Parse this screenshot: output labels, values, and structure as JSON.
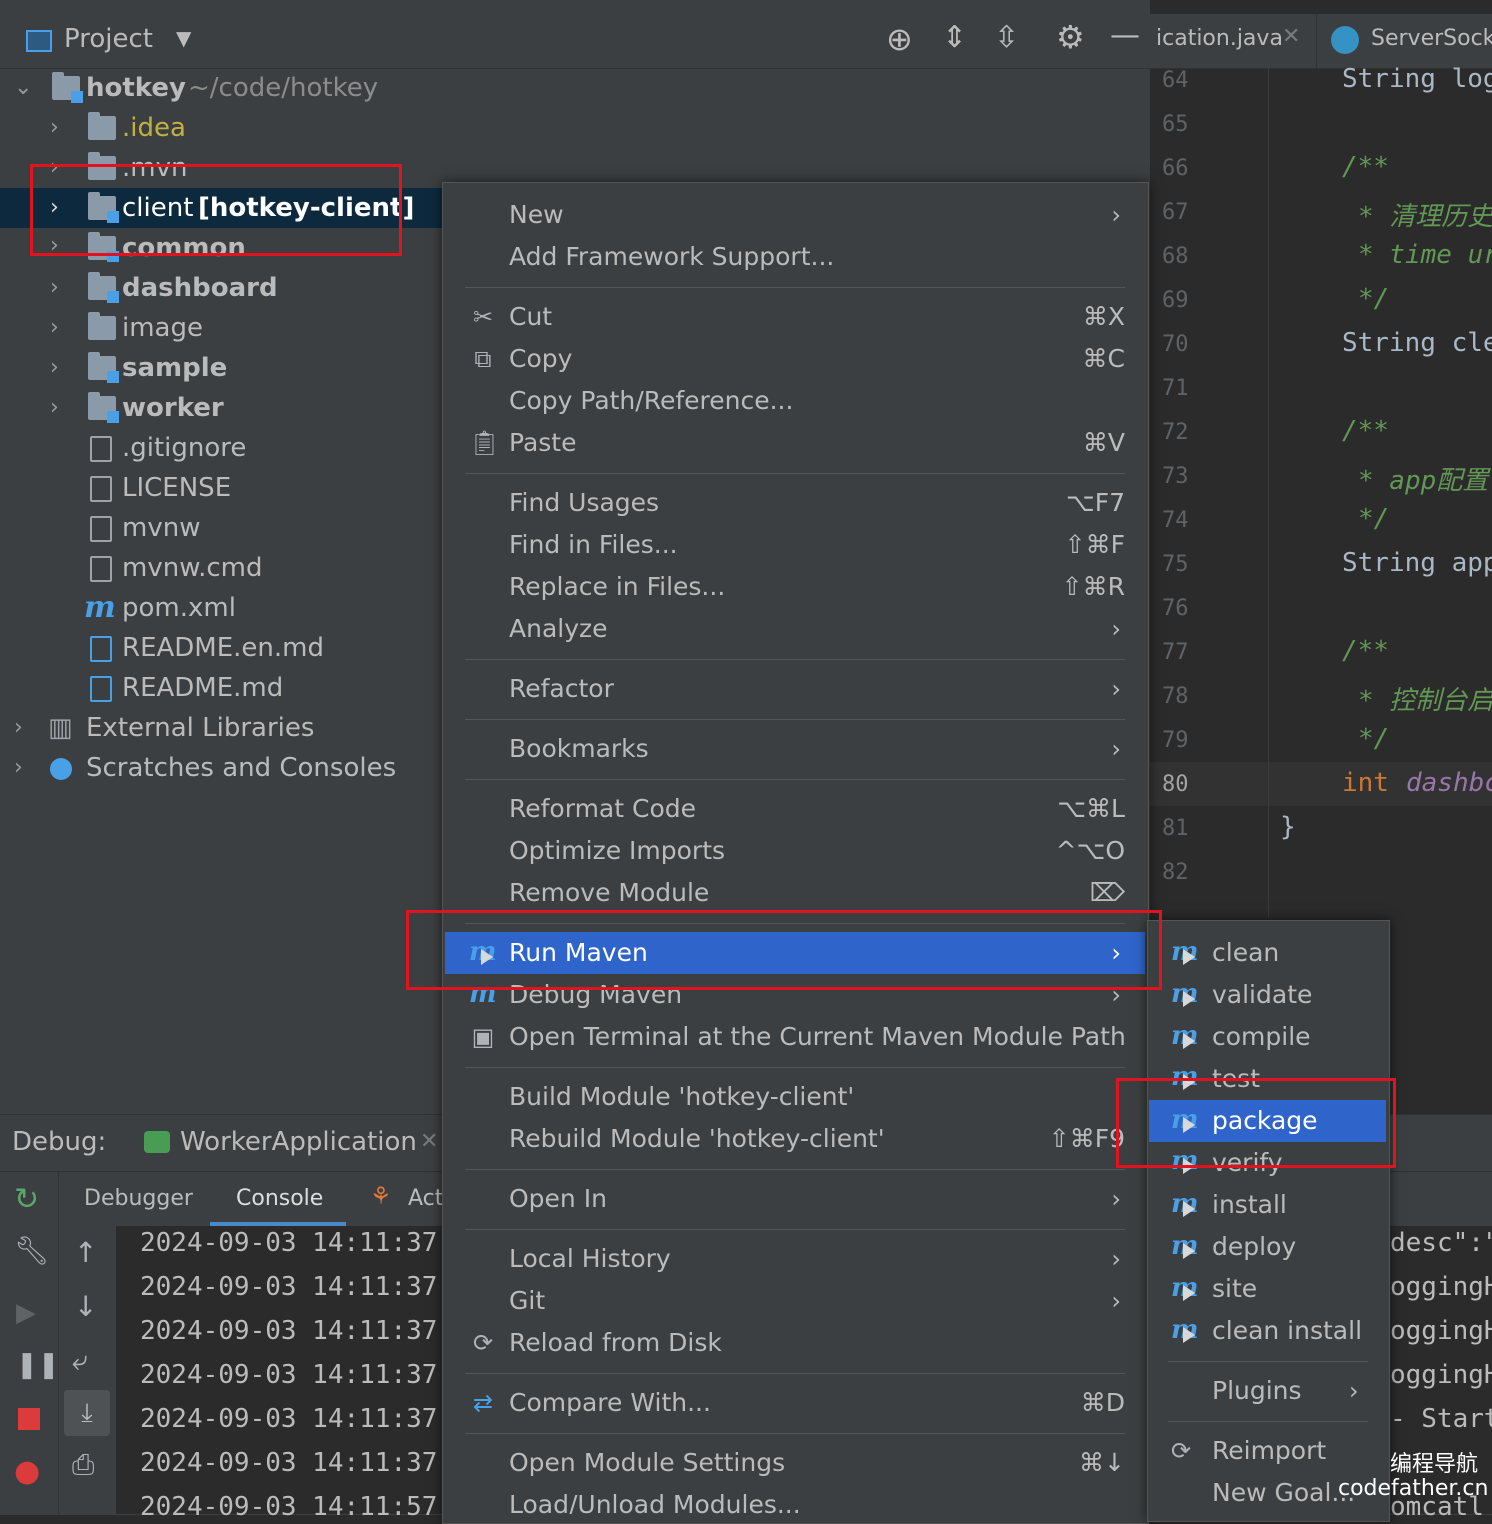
{
  "project_panel": {
    "title": "Project",
    "tree": [
      {
        "label": "hotkey",
        "path": "~/code/hotkey"
      },
      {
        "label": ".idea"
      },
      {
        "label": ".mvn"
      },
      {
        "label": "client",
        "module": "[hotkey-client]"
      },
      {
        "label": "common"
      },
      {
        "label": "dashboard"
      },
      {
        "label": "image"
      },
      {
        "label": "sample"
      },
      {
        "label": "worker"
      },
      {
        "label": ".gitignore"
      },
      {
        "label": "LICENSE"
      },
      {
        "label": "mvnw"
      },
      {
        "label": "mvnw.cmd"
      },
      {
        "label": "pom.xml"
      },
      {
        "label": "README.en.md"
      },
      {
        "label": "README.md"
      },
      {
        "label": "External Libraries"
      },
      {
        "label": "Scratches and Consoles"
      }
    ]
  },
  "editor": {
    "tabs": [
      {
        "label": "ication.java"
      },
      {
        "label": "ServerSocke"
      }
    ],
    "line_numbers": [
      "64",
      "65",
      "66",
      "67",
      "68",
      "69",
      "70",
      "71",
      "72",
      "73",
      "74",
      "75",
      "76",
      "77",
      "78",
      "79",
      "80",
      "81",
      "82"
    ],
    "code_lines": [
      "String log",
      "/**",
      "* 清理历史",
      "* time ur",
      "*/",
      "String cle",
      "/**",
      "* app配置",
      "*/",
      "String app",
      "/**",
      "* 控制台启",
      "*/",
      "int",
      "dashbc",
      "}"
    ]
  },
  "context_menu": {
    "items": [
      {
        "label": "New"
      },
      {
        "label": "Add Framework Support..."
      },
      {
        "label": "Cut",
        "shortcut": "⌘X"
      },
      {
        "label": "Copy",
        "shortcut": "⌘C"
      },
      {
        "label": "Copy Path/Reference..."
      },
      {
        "label": "Paste",
        "shortcut": "⌘V"
      },
      {
        "label": "Find Usages",
        "shortcut": "⌥F7"
      },
      {
        "label": "Find in Files...",
        "shortcut": "⇧⌘F"
      },
      {
        "label": "Replace in Files...",
        "shortcut": "⇧⌘R"
      },
      {
        "label": "Analyze"
      },
      {
        "label": "Refactor"
      },
      {
        "label": "Bookmarks"
      },
      {
        "label": "Reformat Code",
        "shortcut": "⌥⌘L"
      },
      {
        "label": "Optimize Imports",
        "shortcut": "^⌥O"
      },
      {
        "label": "Remove Module",
        "shortcut": "⌦"
      },
      {
        "label": "Run Maven"
      },
      {
        "label": "Debug Maven"
      },
      {
        "label": "Open Terminal at the Current Maven Module Path"
      },
      {
        "label": "Build Module 'hotkey-client'"
      },
      {
        "label": "Rebuild Module 'hotkey-client'",
        "shortcut": "⇧⌘F9"
      },
      {
        "label": "Open In"
      },
      {
        "label": "Local History"
      },
      {
        "label": "Git"
      },
      {
        "label": "Reload from Disk"
      },
      {
        "label": "Compare With...",
        "shortcut": "⌘D"
      },
      {
        "label": "Open Module Settings",
        "shortcut": "⌘↓"
      },
      {
        "label": "Load/Unload Modules..."
      }
    ]
  },
  "maven_submenu": {
    "items": [
      {
        "label": "clean"
      },
      {
        "label": "validate"
      },
      {
        "label": "compile"
      },
      {
        "label": "test"
      },
      {
        "label": "package"
      },
      {
        "label": "verify"
      },
      {
        "label": "install"
      },
      {
        "label": "deploy"
      },
      {
        "label": "site"
      },
      {
        "label": "clean install"
      },
      {
        "label": "Plugins"
      },
      {
        "label": "Reimport"
      },
      {
        "label": "New Goal..."
      }
    ]
  },
  "debug_panel": {
    "title": "Debug:",
    "config": "WorkerApplication",
    "tabs": [
      {
        "label": "Debugger"
      },
      {
        "label": "Console"
      },
      {
        "label": "Act"
      }
    ],
    "console_lines": [
      "2024-09-03 14:11:37",
      "2024-09-03 14:11:37",
      "2024-09-03 14:11:37",
      "2024-09-03 14:11:37",
      "2024-09-03 14:11:37",
      "2024-09-03 14:11:37",
      "2024-09-03 14:11:57"
    ],
    "console_right": [
      "desc\":\"",
      "oggingH",
      "oggingH",
      "oggingH",
      "- Start",
      "",
      "omcatl"
    ]
  },
  "watermark": {
    "line1": "编程导航",
    "line2": "codefather.cn"
  },
  "colors": {
    "selection": "#2f65ca",
    "tree_selection": "#0d293e",
    "highlight_box": "#e0141e",
    "maven_blue": "#4aa0e6"
  }
}
